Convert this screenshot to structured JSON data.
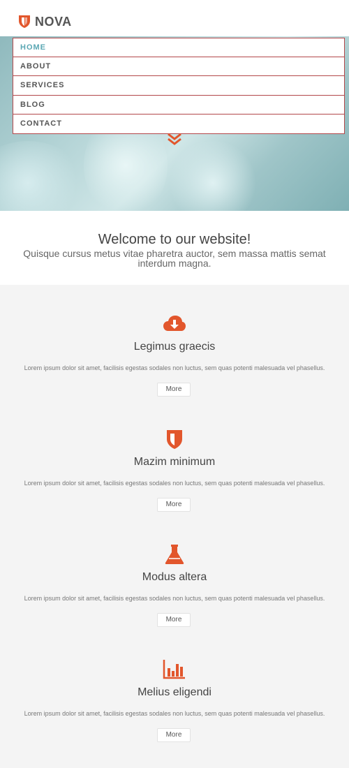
{
  "brand": {
    "name": "NOVA",
    "accent": "#e2562c"
  },
  "nav": {
    "items": [
      "HOME",
      "ABOUT",
      "SERVICES",
      "BLOG",
      "CONTACT"
    ],
    "active_color": "#5aa7b3",
    "border_color": "#b3474a"
  },
  "welcome": {
    "title": "Welcome to our website!",
    "text": "Quisque cursus metus vitae pharetra auctor, sem massa mattis semat interdum magna."
  },
  "features": [
    {
      "icon": "cloud-download-icon",
      "title": "Legimus graecis",
      "text": "Lorem ipsum dolor sit amet, facilisis egestas sodales non luctus, sem quas potenti malesuada vel phasellus.",
      "button": "More"
    },
    {
      "icon": "shield-icon",
      "title": "Mazim minimum",
      "text": "Lorem ipsum dolor sit amet, facilisis egestas sodales non luctus, sem quas potenti malesuada vel phasellus.",
      "button": "More"
    },
    {
      "icon": "flask-icon",
      "title": "Modus altera",
      "text": "Lorem ipsum dolor sit amet, facilisis egestas sodales non luctus, sem quas potenti malesuada vel phasellus.",
      "button": "More"
    },
    {
      "icon": "bar-chart-icon",
      "title": "Melius eligendi",
      "text": "Lorem ipsum dolor sit amet, facilisis egestas sodales non luctus, sem quas potenti malesuada vel phasellus.",
      "button": "More"
    }
  ]
}
